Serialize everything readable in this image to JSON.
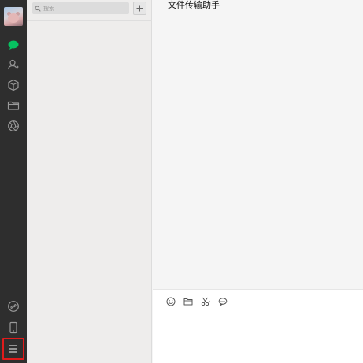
{
  "sidebar": {
    "items": [
      {
        "name": "chat",
        "icon": "chat-bubble-icon",
        "active": true
      },
      {
        "name": "contacts",
        "icon": "contacts-icon"
      },
      {
        "name": "collections",
        "icon": "cube-icon"
      },
      {
        "name": "files",
        "icon": "folder-icon"
      },
      {
        "name": "moments",
        "icon": "aperture-icon"
      }
    ],
    "bottom": [
      {
        "name": "mini-programs",
        "icon": "link-icon"
      },
      {
        "name": "phone",
        "icon": "phone-icon"
      },
      {
        "name": "menu",
        "icon": "hamburger-menu-icon",
        "highlighted": true
      }
    ]
  },
  "search": {
    "placeholder": "搜索"
  },
  "chat": {
    "title": "文件传输助手"
  },
  "compose": {
    "tools": [
      "emoji-icon",
      "folder-icon",
      "scissors-icon",
      "chat-history-icon"
    ]
  },
  "colors": {
    "rail_bg": "#2e2e2e",
    "active_green": "#07c160",
    "highlight_red": "#e01b1b",
    "list_bg": "#eeedec",
    "chat_bg": "#f5f5f5"
  }
}
